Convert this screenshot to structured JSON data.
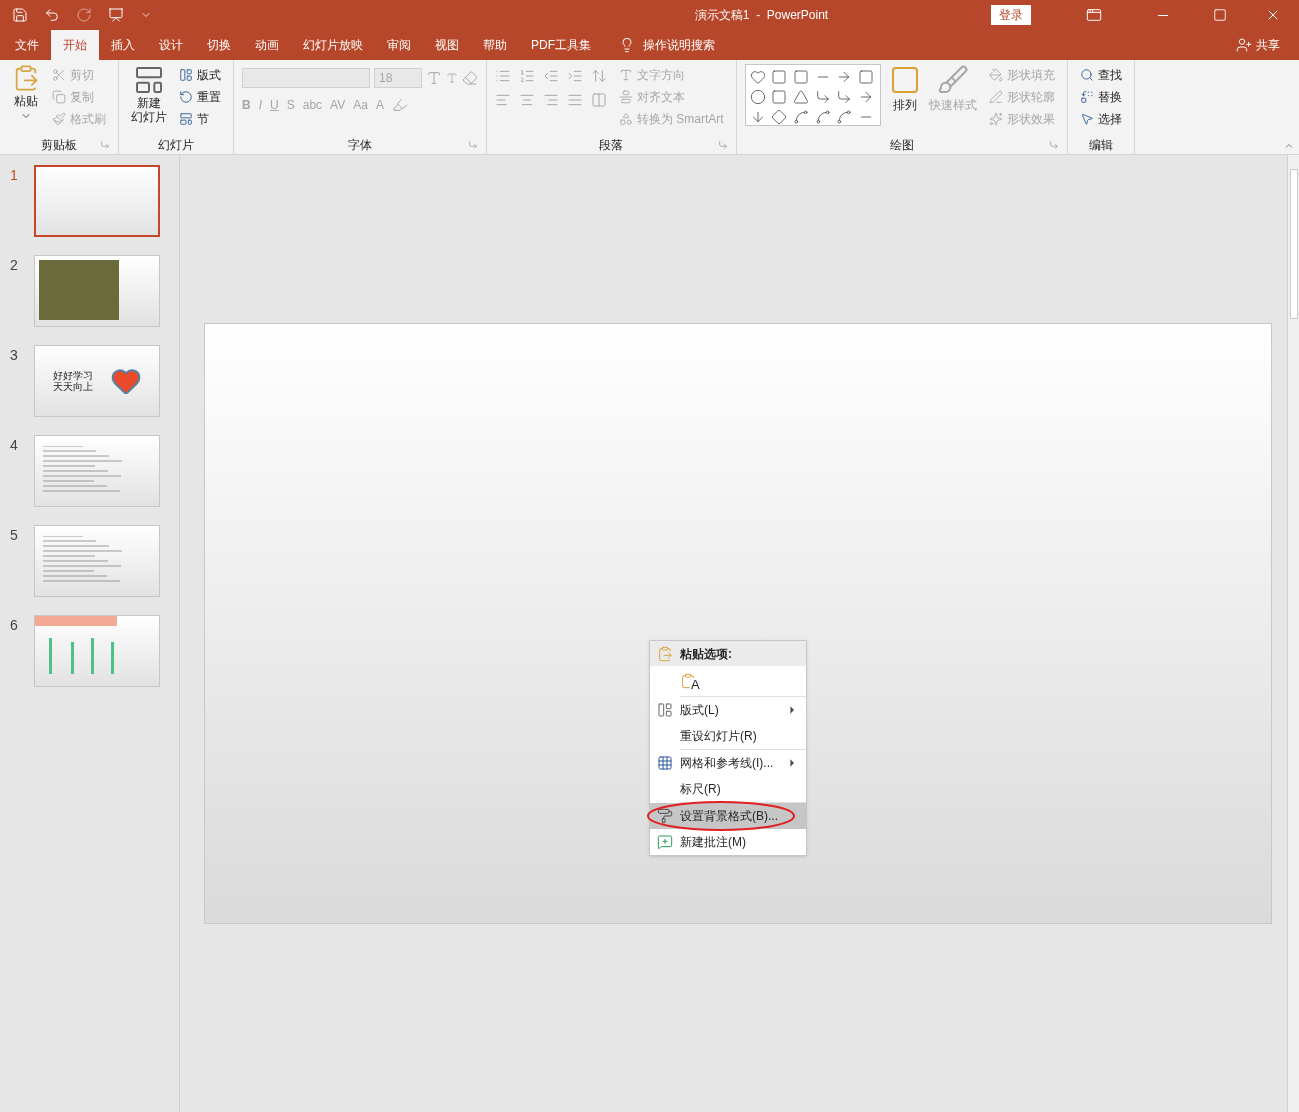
{
  "title_bar": {
    "title": "演示文稿1  -  PowerPoint",
    "login": "登录"
  },
  "tabs": [
    {
      "label": "文件",
      "selected": false
    },
    {
      "label": "开始",
      "selected": true
    },
    {
      "label": "插入",
      "selected": false
    },
    {
      "label": "设计",
      "selected": false
    },
    {
      "label": "切换",
      "selected": false
    },
    {
      "label": "动画",
      "selected": false
    },
    {
      "label": "幻灯片放映",
      "selected": false
    },
    {
      "label": "审阅",
      "selected": false
    },
    {
      "label": "视图",
      "selected": false
    },
    {
      "label": "帮助",
      "selected": false
    },
    {
      "label": "PDF工具集",
      "selected": false
    }
  ],
  "tell_me": "操作说明搜索",
  "share": "共享",
  "ribbon": [
    {
      "kind": "clipboard",
      "label": "剪贴板",
      "launcher": true,
      "items": [
        {
          "label": "粘贴",
          "disabled": false
        },
        {
          "label": "剪切",
          "disabled": true
        },
        {
          "label": "复制",
          "disabled": true
        },
        {
          "label": "格式刷",
          "disabled": true
        }
      ]
    },
    {
      "kind": "slides",
      "label": "幻灯片",
      "launcher": false,
      "items": [
        {
          "label_lines": [
            "新建",
            "幻灯片"
          ],
          "disabled": false
        },
        {
          "label": "版式",
          "disabled": false
        },
        {
          "label": "重置",
          "disabled": false
        },
        {
          "label": "节",
          "disabled": false
        }
      ]
    },
    {
      "kind": "font",
      "label": "字体",
      "launcher": true,
      "size": "18",
      "glyphs": [
        "B",
        "I",
        "U",
        "S",
        "abc",
        "AV",
        "Aa",
        "A"
      ]
    },
    {
      "kind": "paragraph",
      "label": "段落",
      "launcher": true,
      "items": [
        {
          "label": "文字方向",
          "disabled": true
        },
        {
          "label": "对齐文本",
          "disabled": true
        },
        {
          "label": "转换为 SmartArt",
          "disabled": true
        }
      ]
    },
    {
      "kind": "drawing",
      "label": "绘图",
      "launcher": true,
      "items": [
        {
          "label": "排列",
          "disabled": false
        },
        {
          "label": "快速样式",
          "disabled": true
        },
        {
          "label": "形状填充",
          "disabled": true
        },
        {
          "label": "形状轮廓",
          "disabled": true
        },
        {
          "label": "形状效果",
          "disabled": true
        }
      ]
    },
    {
      "kind": "editing",
      "label": "编辑",
      "launcher": false,
      "items": [
        {
          "label": "查找",
          "disabled": false
        },
        {
          "label": "替换",
          "disabled": false
        },
        {
          "label": "选择",
          "disabled": false
        }
      ]
    }
  ],
  "slides": [
    {
      "number": "1",
      "selected": true,
      "kind": "blank"
    },
    {
      "number": "2",
      "selected": false,
      "kind": "photo"
    },
    {
      "number": "3",
      "selected": false,
      "kind": "text_heart",
      "text": "好好学习天天向上"
    },
    {
      "number": "4",
      "selected": false,
      "kind": "lines"
    },
    {
      "number": "5",
      "selected": false,
      "kind": "lines"
    },
    {
      "number": "6",
      "selected": false,
      "kind": "chart"
    }
  ],
  "context_menu": {
    "header": "粘贴选项:",
    "paste_glyph": "A",
    "items": [
      {
        "label": "版式(L)",
        "kind": "layout",
        "submenu": true,
        "highlighted": false,
        "divider_before": true
      },
      {
        "label": "重设幻灯片(R)",
        "kind": "plain",
        "submenu": false,
        "highlighted": false,
        "divider_before": false
      },
      {
        "label": "网格和参考线(I)...",
        "kind": "grid",
        "submenu": true,
        "highlighted": false,
        "divider_before": true
      },
      {
        "label": "标尺(R)",
        "kind": "plain",
        "submenu": false,
        "highlighted": false,
        "divider_before": false
      },
      {
        "label": "设置背景格式(B)...",
        "kind": "background",
        "submenu": false,
        "highlighted": true,
        "divider_before": true,
        "circled": true
      },
      {
        "label": "新建批注(M)",
        "kind": "comment",
        "submenu": false,
        "highlighted": false,
        "divider_before": false
      }
    ]
  }
}
